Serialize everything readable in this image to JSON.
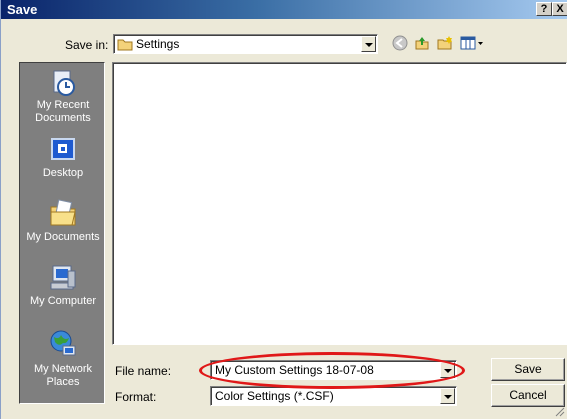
{
  "window": {
    "title": "Save",
    "help_label": "?",
    "close_label": "X"
  },
  "save_in": {
    "label": "Save in:",
    "value": "Settings"
  },
  "places": [
    {
      "label": "My Recent Documents",
      "icon": "recent-documents-icon"
    },
    {
      "label": "Desktop",
      "icon": "desktop-icon"
    },
    {
      "label": "My Documents",
      "icon": "my-documents-icon"
    },
    {
      "label": "My Computer",
      "icon": "my-computer-icon"
    },
    {
      "label": "My Network Places",
      "icon": "network-places-icon"
    }
  ],
  "file_name": {
    "label": "File name:",
    "value": "My Custom Settings 18-07-08"
  },
  "format": {
    "label": "Format:",
    "value": "Color Settings (*.CSF)"
  },
  "buttons": {
    "save": "Save",
    "cancel": "Cancel"
  },
  "colors": {
    "highlight_ellipse": "#e01818",
    "title_bar": "#0a246a"
  }
}
